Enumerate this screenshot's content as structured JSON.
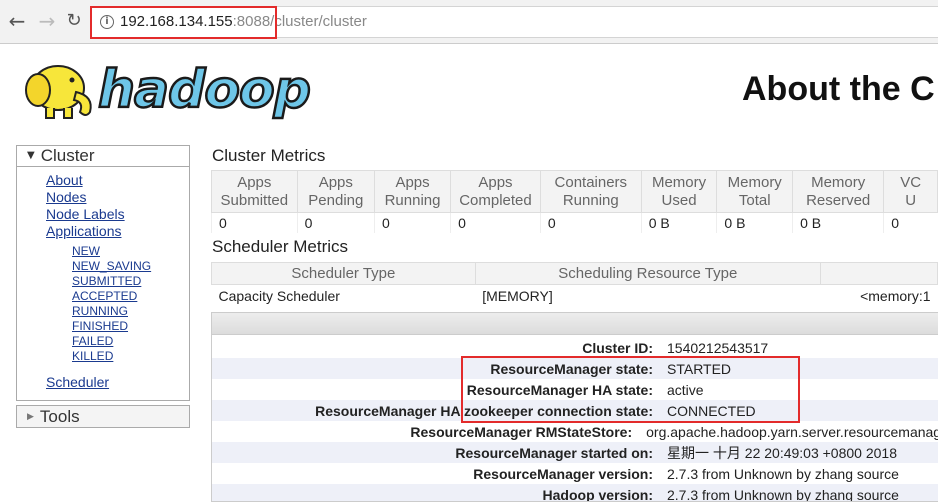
{
  "browser": {
    "url_host": "192.168.134.155",
    "url_rest": ":8088/cluster/cluster",
    "back_icon": "arrow-left-icon",
    "forward_icon": "arrow-right-icon",
    "reload_icon": "reload-icon",
    "info_icon": "info-icon"
  },
  "header": {
    "logo_text": "hadoop",
    "title": "About the C"
  },
  "sidebar": {
    "cluster_label": "Cluster",
    "links": [
      "About",
      "Nodes",
      "Node Labels",
      "Applications"
    ],
    "app_states": [
      "NEW",
      "NEW_SAVING",
      "SUBMITTED",
      "ACCEPTED",
      "RUNNING",
      "FINISHED",
      "FAILED",
      "KILLED"
    ],
    "scheduler_label": "Scheduler",
    "tools_label": "Tools"
  },
  "cluster_metrics": {
    "title": "Cluster Metrics",
    "headers": [
      [
        "Apps",
        "Submitted"
      ],
      [
        "Apps",
        "Pending"
      ],
      [
        "Apps",
        "Running"
      ],
      [
        "Apps",
        "Completed"
      ],
      [
        "Containers",
        "Running"
      ],
      [
        "Memory",
        "Used"
      ],
      [
        "Memory",
        "Total"
      ],
      [
        "Memory",
        "Reserved"
      ],
      [
        "VC",
        "U"
      ]
    ],
    "values": [
      "0",
      "0",
      "0",
      "0",
      "0",
      "0 B",
      "0 B",
      "0 B",
      "0"
    ]
  },
  "scheduler_metrics": {
    "title": "Scheduler Metrics",
    "headers": [
      "Scheduler Type",
      "Scheduling Resource Type",
      ""
    ],
    "row": [
      "Capacity Scheduler",
      "[MEMORY]",
      "<memory:1"
    ]
  },
  "about": {
    "rows": [
      {
        "key": "Cluster ID:",
        "value": "1540212543517"
      },
      {
        "key": "ResourceManager state:",
        "value": "STARTED"
      },
      {
        "key": "ResourceManager HA state:",
        "value": "active"
      },
      {
        "key": "ResourceManager HA zookeeper connection state:",
        "value": "CONNECTED"
      },
      {
        "key": "ResourceManager RMStateStore:",
        "value": "org.apache.hadoop.yarn.server.resourcemanager"
      },
      {
        "key": "ResourceManager started on:",
        "value": "星期一 十月 22 20:49:03 +0800 2018"
      },
      {
        "key": "ResourceManager version:",
        "value": "2.7.3 from Unknown by zhang source"
      },
      {
        "key": "Hadoop version:",
        "value": "2.7.3 from Unknown by zhang source"
      }
    ]
  },
  "colors": {
    "highlight": "#e32b2b",
    "link": "#1a3a8f",
    "logo_yellow": "#f7e63a",
    "logo_blue": "#6ec6e8"
  }
}
